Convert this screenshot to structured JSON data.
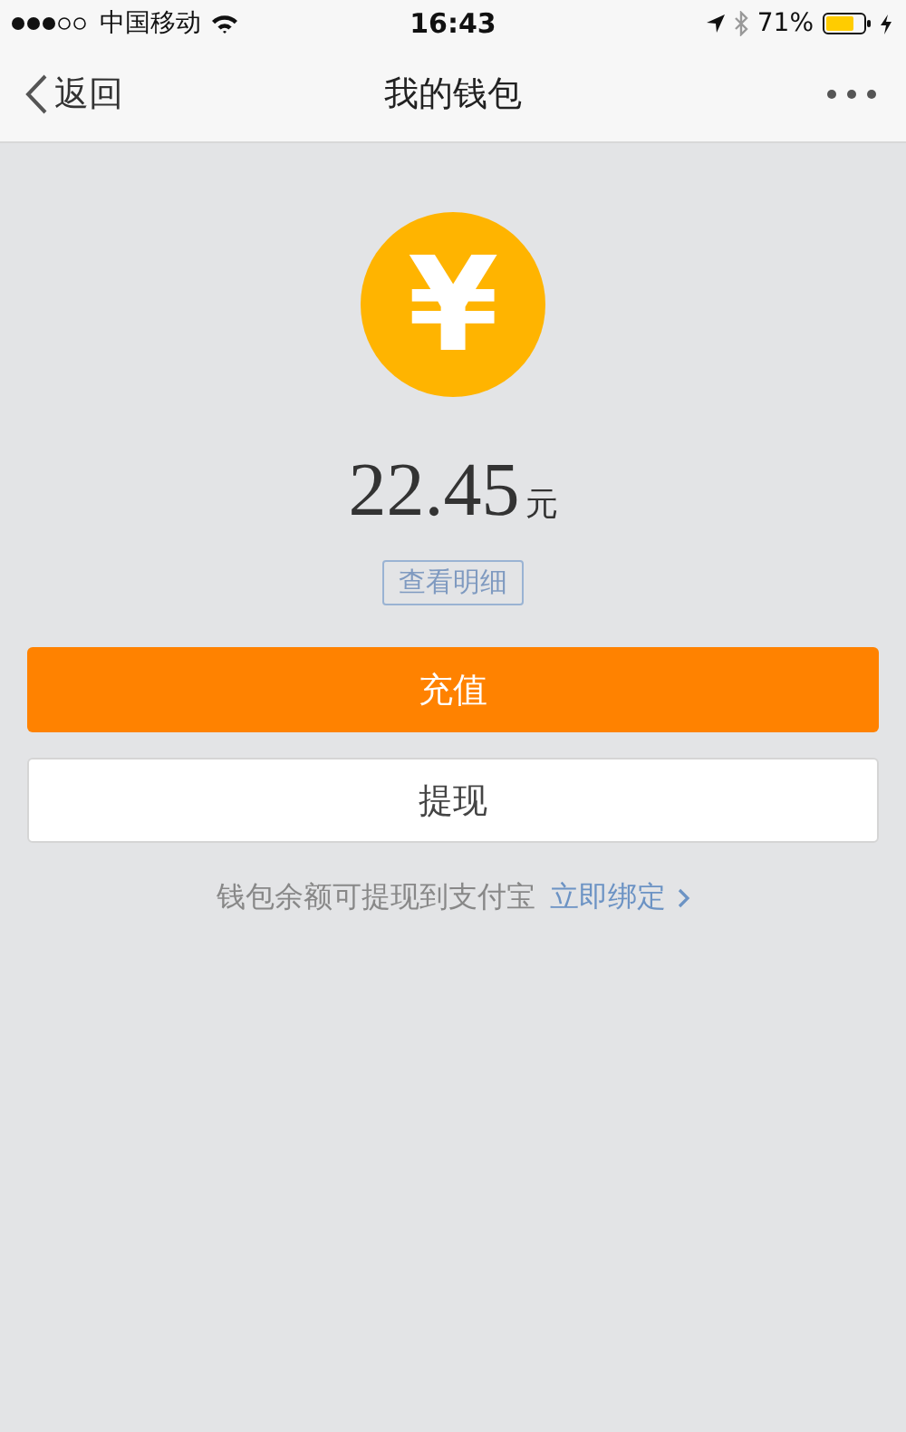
{
  "status_bar": {
    "carrier": "中国移动",
    "time": "16:43",
    "battery": "71%"
  },
  "nav": {
    "back": "返回",
    "title": "我的钱包"
  },
  "wallet": {
    "currency_symbol": "¥",
    "amount": "22.45",
    "unit": "元",
    "details_button": "查看明细"
  },
  "buttons": [
    {
      "label": "充值",
      "kind": "primary"
    },
    {
      "label": "提现",
      "kind": "secondary"
    }
  ],
  "note": {
    "text": "钱包余额可提现到支付宝",
    "link": "立即绑定"
  }
}
